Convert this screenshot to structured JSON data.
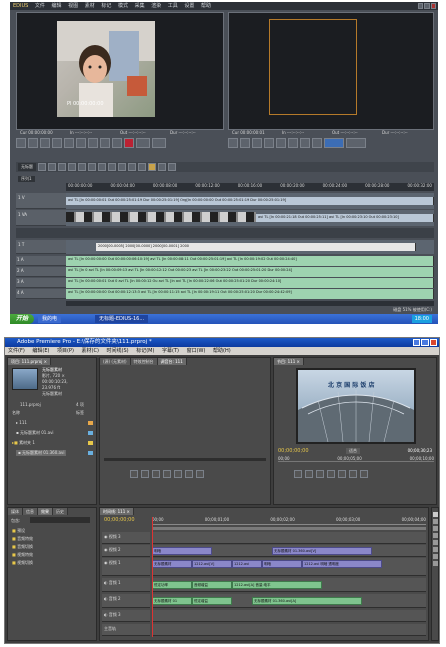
{
  "edius": {
    "app_name": "EDIUS",
    "menu": [
      "文件",
      "编辑",
      "视图",
      "素材",
      "标记",
      "模式",
      "采集",
      "渲染",
      "工具",
      "设置",
      "帮助"
    ],
    "player_timecode": "Pl 00:00:00:00",
    "player_in": "Cur 00:00:00:00",
    "player_out": "In ---:--:--:--",
    "player_out2": "Out ---:--:--:--",
    "player_dur": "Dur ---:--:--:--",
    "recorder_in": "Cur 00:00:00:01",
    "recorder_out": "In ---:--:--:--",
    "recorder_out2": "Out ---:--:--:--",
    "recorder_dur": "Dur ---:--:--:--",
    "sequence_tab": "序列1",
    "timeline_tab": "无标题",
    "ruler": [
      "00:00:00:00",
      "00:00:04:00",
      "00:00:08:00",
      "00:00:12:00",
      "00:00:16:00",
      "00:00:20:00",
      "00:00:24:00",
      "00:00:28:00",
      "00:00:32:00"
    ],
    "tracks": [
      {
        "name": "1 V",
        "clip": "avi  TL [In 00:00:00:01 Out 00:00:25:01:19  Dur 00:00:25:01:19]  Org[In 00:00:00:00 Out 00:00:25:01:19 Dur 00:00:25:01:19]"
      },
      {
        "name": "1 VA",
        "clip": "avi   TL [In 00:00:21:18 Out 00:00:25:11]   avi  TL [In 00:00:23:10 Out 00:00:23:10]"
      },
      {
        "name": "1 T",
        "clip": "2000[00-0005]   2000[00-0000]   2000[00-0001]   2000"
      },
      {
        "name": "1 A",
        "clip": "avi  TL [In 00:00:00:00 Out 00:00:00:06:10:19]  avi  TL [In 00:00:08:11 Out 00:00:25:01:19]  avi  TL [In 00:00:19:02 Out 00:00:24:40]"
      },
      {
        "name": "2 A",
        "clip": "avi  TL [In 0  avi  TL [In 00:00:09:13  avi  TL [In 00:00:12:12 Out 00:00:23  avi  TL [In 00:00:23:22 Out 00:00:25:01:20 Dur 00:00:24]"
      },
      {
        "name": "3 A",
        "clip": "avi  TL [In 00:00:00:01 Out 0  avi  TL [In 00:00:12 Ou  avi  TL [In  avi  TL [In 00:00:22:06 Out 00:00:25:01:20 Dur 00:00:24:10]"
      },
      {
        "name": "4 A",
        "clip": "avi  TL [In 00:00:00:00 Out 00:00:12:13:3  avi  TL [In 00:00:11:15  avi  TL [In 00:00:19:11 Out 00:00:25:01:20 Dur 00:00:24:42:09]"
      }
    ],
    "statusbar": "磁盘 51% 被使用(C:)",
    "taskbar": {
      "start": "开始",
      "task1": "我的电",
      "task2": "无标题-EDIUS-16...",
      "clock": "18:00"
    }
  },
  "premiere": {
    "title": "Adobe Premiere Pro - E:\\保存的文件夹\\111.prproj *",
    "menu": [
      "文件(F)",
      "编辑(E)",
      "项目(P)",
      "素材(C)",
      "时间线(S)",
      "标记(M)",
      "字幕(T)",
      "窗口(W)",
      "帮助(H)"
    ],
    "project_tab": "项目: 111.prproj ×",
    "source_tab": "(源) (无素材)",
    "effects_tab": "特效控制台",
    "mixer_tab": "调音台: 111",
    "program_tab": "节目: 111 ×",
    "clip_info": [
      "无标题素材",
      "影片, 720 ×",
      "00:00:10:23,",
      "23.976 ft",
      "无标题素材"
    ],
    "project_name": "111.prproj",
    "item_count": "4 项",
    "col_name": "名称",
    "col_label": "标签",
    "bins": [
      {
        "name": "111"
      },
      {
        "name": "无标题素材 01.avi"
      },
      {
        "name": "素材夹 1"
      },
      {
        "name": "无标题素材 01.360.avi"
      }
    ],
    "program_timecode": "00;00;00;00",
    "program_duration": "00;00;30;23",
    "fit_label": "适合",
    "program_ruler": [
      "00;00",
      "00;00;05;00",
      "00;00;10;00"
    ],
    "program_image_text": "北 京 国 际 饭 店",
    "left_tabs": [
      "媒体",
      "信息",
      "效果",
      "历史"
    ],
    "contains_label": "包含:",
    "effects_tree": [
      "预设",
      "音频特效",
      "音频切换",
      "视频特效",
      "视频切换"
    ],
    "timeline_tab": "时间线: 111 ×",
    "timeline_tc": "00;00;00;00",
    "timeline_ruler": [
      "00;00",
      "00;00;01;00",
      "00;00;02;00",
      "00;00;03;00",
      "00;00;04;00"
    ],
    "tracks": [
      {
        "name": "视频 3",
        "clips": []
      },
      {
        "name": "视频 2",
        "clips": [
          "明暗",
          "无标题素材 01.360.avi[V]"
        ]
      },
      {
        "name": "视频 1",
        "clips": [
          "无标题素材",
          "1212.avi[V]",
          "1212.avi",
          "明暗",
          "1212.avi 明暗 透明度"
        ]
      },
      {
        "name": "音频 1",
        "clips": [
          "恒定功率",
          "音频增益",
          "1212.avi[A] 音量:电平"
        ]
      },
      {
        "name": "音频 2",
        "clips": [
          "无标题素材 01",
          "恒定增益",
          "无标题素材 01.360.avi[A]"
        ]
      },
      {
        "name": "音频 3",
        "clips": []
      },
      {
        "name": "主音轨",
        "clips": []
      }
    ]
  },
  "colors": {
    "edius_bg": "#4a4f57",
    "premiere_bg": "#3d3d3d",
    "taskbar": "#2452b8",
    "video_clip": "#8a87c9",
    "audio_clip": "#7fc48e",
    "timecode": "#e8c84a"
  }
}
